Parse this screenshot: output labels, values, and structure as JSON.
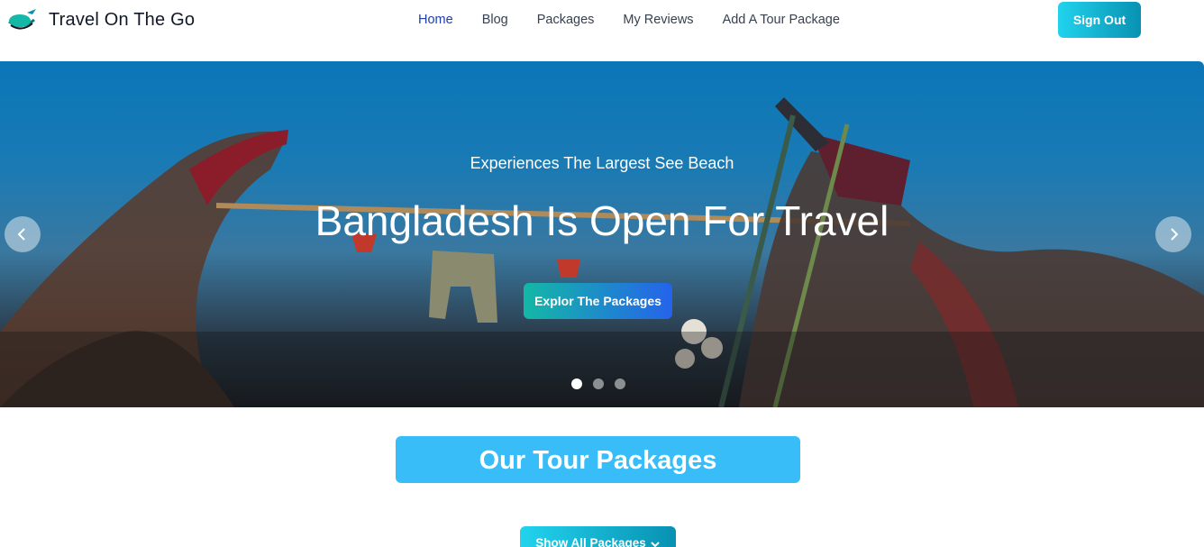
{
  "brand": {
    "name": "Travel On The Go",
    "logo_icon": "plane-globe-icon"
  },
  "nav": {
    "items": [
      {
        "label": "Home",
        "active": true
      },
      {
        "label": "Blog",
        "active": false
      },
      {
        "label": "Packages",
        "active": false
      },
      {
        "label": "My Reviews",
        "active": false
      },
      {
        "label": "Add A Tour Package",
        "active": false
      }
    ]
  },
  "auth": {
    "signout_label": "Sign Out"
  },
  "hero": {
    "subtitle": "Experiences The Largest See Beach",
    "title": "Bangladesh Is Open For Travel",
    "cta_label": "Explor The Packages",
    "prev_icon": "chevron-left-icon",
    "next_icon": "chevron-right-icon",
    "slides_total": 3,
    "active_slide": 1
  },
  "packages": {
    "heading": "Our Tour Packages",
    "show_all_label": "Show All Packages",
    "show_all_icon": "chevron-down-icon"
  },
  "colors": {
    "accent": "#38bdf8",
    "nav_active": "#1e40af",
    "button_gradient_start": "#22d3ee",
    "button_gradient_end": "#0891b2"
  }
}
